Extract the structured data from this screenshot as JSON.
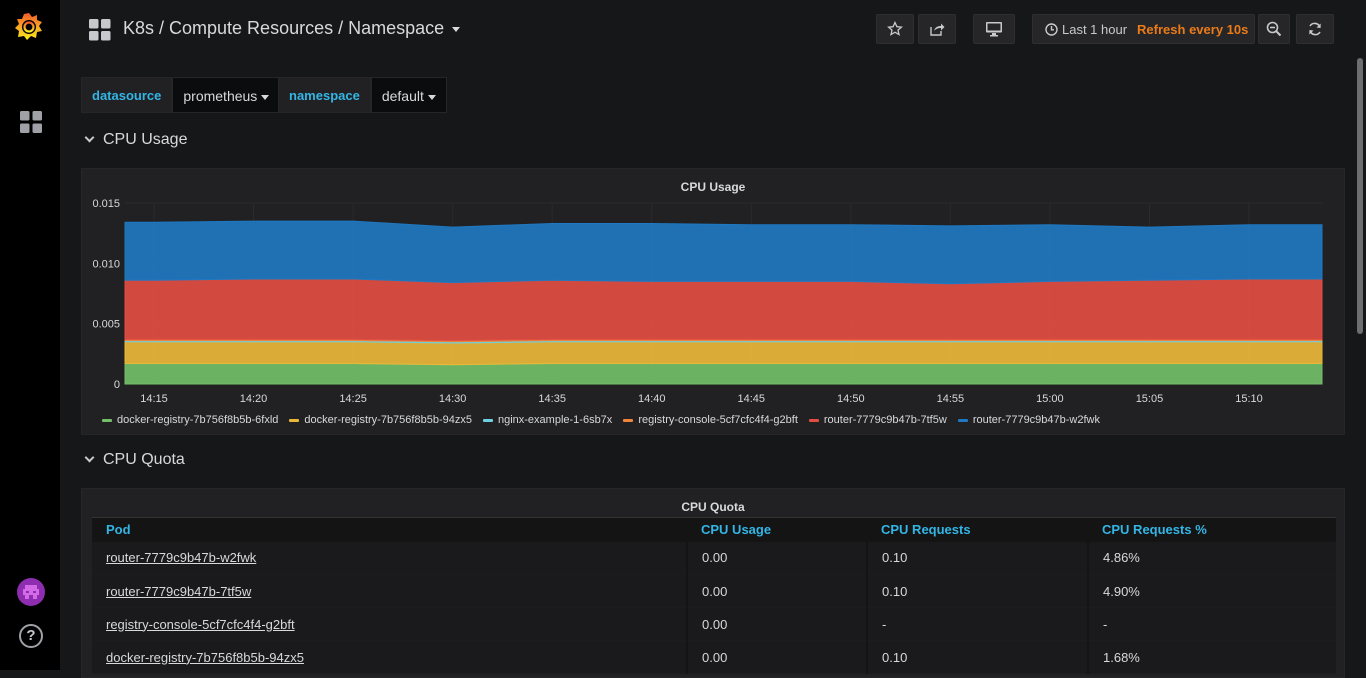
{
  "navbar": {
    "title": "K8s / Compute Resources / Namespace",
    "time_range": "Last 1 hour",
    "refresh": "Refresh every 10s"
  },
  "variables": [
    {
      "label": "datasource",
      "value": "prometheus"
    },
    {
      "label": "namespace",
      "value": "default"
    }
  ],
  "rows": {
    "cpu_usage": "CPU Usage",
    "cpu_quota": "CPU Quota"
  },
  "chart_data": {
    "type": "area",
    "stacked": true,
    "title": "CPU Usage",
    "x": [
      "14:15",
      "14:20",
      "14:25",
      "14:30",
      "14:35",
      "14:40",
      "14:45",
      "14:50",
      "14:55",
      "15:00",
      "15:05",
      "15:10"
    ],
    "ytick_labels": [
      "0",
      "0.005",
      "0.010",
      "0.015"
    ],
    "ylim": [
      0,
      0.015
    ],
    "legend_position": "bottom",
    "series": [
      {
        "name": "docker-registry-7b756f8b5b-6fxld",
        "color": "#73bf69",
        "values": [
          0.0017,
          0.0017,
          0.0017,
          0.0016,
          0.0017,
          0.0017,
          0.0017,
          0.0017,
          0.0017,
          0.0017,
          0.0017,
          0.0017
        ]
      },
      {
        "name": "docker-registry-7b756f8b5b-94zx5",
        "color": "#eab839",
        "values": [
          0.0018,
          0.0018,
          0.0018,
          0.0018,
          0.0018,
          0.0018,
          0.0018,
          0.0018,
          0.0018,
          0.0018,
          0.0018,
          0.0018
        ]
      },
      {
        "name": "nginx-example-1-6sb7x",
        "color": "#6ed0e0",
        "values": [
          0.0001,
          0.0001,
          0.0001,
          0.0001,
          0.0001,
          0.0001,
          0.0001,
          0.0001,
          0.0001,
          0.0001,
          0.0001,
          0.0001
        ]
      },
      {
        "name": "registry-console-5cf7cfc4f4-g2bft",
        "color": "#ef843c",
        "values": [
          0.0001,
          0.0001,
          0.0001,
          0.0001,
          0.0001,
          0.0001,
          0.0001,
          0.0001,
          0.0001,
          0.0001,
          0.0001,
          0.0001
        ]
      },
      {
        "name": "router-7779c9b47b-7tf5w",
        "color": "#e24d42",
        "values": [
          0.0049,
          0.005,
          0.005,
          0.0048,
          0.0049,
          0.0048,
          0.0048,
          0.0048,
          0.0046,
          0.0048,
          0.0049,
          0.005
        ]
      },
      {
        "name": "router-7779c9b47b-w2fwk",
        "color": "#1f78c1",
        "values": [
          0.0048,
          0.0048,
          0.0048,
          0.0046,
          0.0047,
          0.0048,
          0.0047,
          0.0047,
          0.0048,
          0.0047,
          0.0044,
          0.0045
        ]
      }
    ]
  },
  "quota_table": {
    "title": "CPU Quota",
    "columns": [
      "Pod",
      "CPU Usage",
      "CPU Requests",
      "CPU Requests %"
    ],
    "rows": [
      [
        "router-7779c9b47b-w2fwk",
        "0.00",
        "0.10",
        "4.86%"
      ],
      [
        "router-7779c9b47b-7tf5w",
        "0.00",
        "0.10",
        "4.90%"
      ],
      [
        "registry-console-5cf7cfc4f4-g2bft",
        "0.00",
        "-",
        "-"
      ],
      [
        "docker-registry-7b756f8b5b-94zx5",
        "0.00",
        "0.10",
        "1.68%"
      ]
    ]
  }
}
